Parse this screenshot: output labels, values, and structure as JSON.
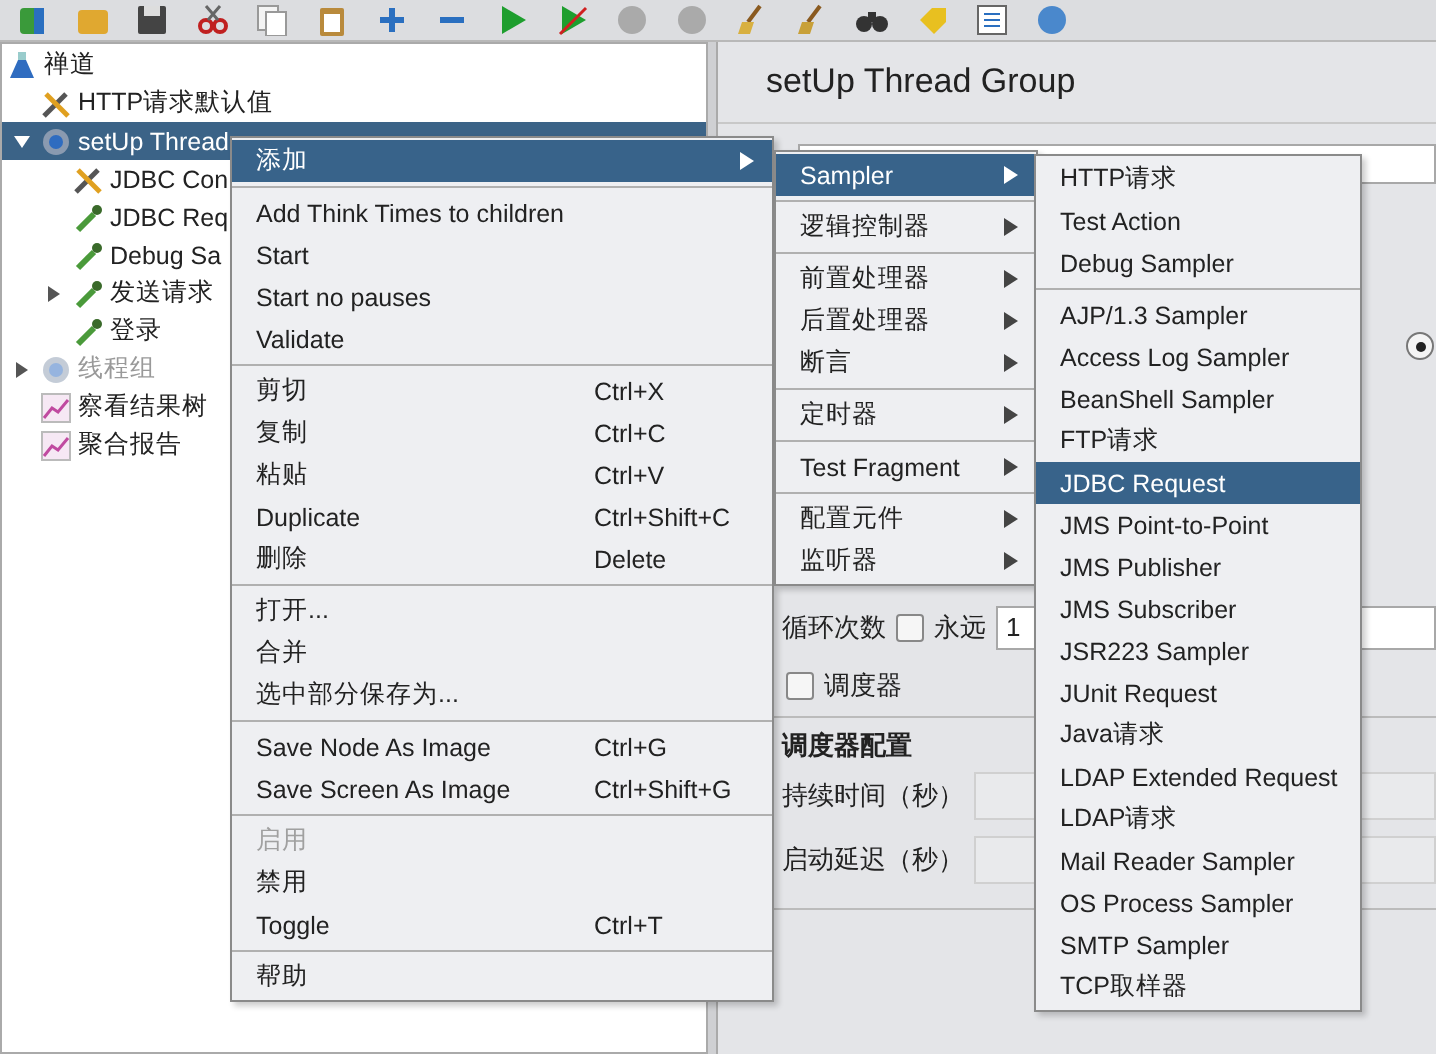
{
  "tree": [
    {
      "label": "禅道",
      "kind": "plan",
      "selected": false,
      "disabled": false,
      "children": [
        {
          "label": "HTTP请求默认值",
          "kind": "config",
          "selected": false,
          "disabled": false
        },
        {
          "label": "setUp Thread",
          "kind": "threads",
          "selected": true,
          "disabled": false,
          "expanded": true,
          "children": [
            {
              "label": "JDBC Con",
              "kind": "config",
              "selected": false,
              "disabled": false
            },
            {
              "label": "JDBC Req",
              "kind": "sampler",
              "selected": false,
              "disabled": false
            },
            {
              "label": "Debug Sa",
              "kind": "sampler",
              "selected": false,
              "disabled": false
            },
            {
              "label": "发送请求",
              "kind": "sampler",
              "selected": false,
              "disabled": false,
              "expanded": false
            },
            {
              "label": "登录",
              "kind": "sampler",
              "selected": false,
              "disabled": false
            }
          ]
        },
        {
          "label": "线程组",
          "kind": "threads",
          "selected": false,
          "disabled": true,
          "expanded": false
        },
        {
          "label": "察看结果树",
          "kind": "listener",
          "selected": false,
          "disabled": false
        },
        {
          "label": "聚合报告",
          "kind": "listener",
          "selected": false,
          "disabled": false
        }
      ]
    }
  ],
  "panel": {
    "title": "setUp Thread Group",
    "radio": {
      "selected": true
    },
    "loop": {
      "label": "循环次数",
      "forever": {
        "label": "永远",
        "checked": false
      },
      "value": "1"
    },
    "scheduler": {
      "label": "调度器",
      "checked": false
    },
    "scheduler_config": {
      "title": "调度器配置",
      "fields": [
        {
          "label": "持续时间（秒）"
        },
        {
          "label": "启动延迟（秒）"
        }
      ]
    }
  },
  "context_menu": {
    "sections": [
      [
        {
          "label": "添加",
          "selected": true,
          "disabled": false,
          "submenu": true
        }
      ],
      [
        {
          "label": "Add Think Times to children",
          "selected": false,
          "disabled": false
        },
        {
          "label": "Start",
          "selected": false,
          "disabled": false
        },
        {
          "label": "Start no pauses",
          "selected": false,
          "disabled": false
        },
        {
          "label": "Validate",
          "selected": false,
          "disabled": false
        }
      ],
      [
        {
          "label": "剪切",
          "shortcut": "Ctrl+X",
          "selected": false,
          "disabled": false
        },
        {
          "label": "复制",
          "shortcut": "Ctrl+C",
          "selected": false,
          "disabled": false
        },
        {
          "label": "粘贴",
          "shortcut": "Ctrl+V",
          "selected": false,
          "disabled": false
        },
        {
          "label": "Duplicate",
          "shortcut": "Ctrl+Shift+C",
          "selected": false,
          "disabled": false
        },
        {
          "label": "删除",
          "shortcut": "Delete",
          "selected": false,
          "disabled": false
        }
      ],
      [
        {
          "label": "打开...",
          "selected": false,
          "disabled": false
        },
        {
          "label": "合并",
          "selected": false,
          "disabled": false
        },
        {
          "label": "选中部分保存为...",
          "selected": false,
          "disabled": false
        }
      ],
      [
        {
          "label": "Save Node As Image",
          "shortcut": "Ctrl+G",
          "selected": false,
          "disabled": false
        },
        {
          "label": "Save Screen As Image",
          "shortcut": "Ctrl+Shift+G",
          "selected": false,
          "disabled": false
        }
      ],
      [
        {
          "label": "启用",
          "selected": false,
          "disabled": true
        },
        {
          "label": "禁用",
          "selected": false,
          "disabled": false
        },
        {
          "label": "Toggle",
          "shortcut": "Ctrl+T",
          "selected": false,
          "disabled": false
        }
      ],
      [
        {
          "label": "帮助",
          "selected": false,
          "disabled": false
        }
      ]
    ]
  },
  "add_menu": {
    "sections": [
      [
        {
          "label": "Sampler",
          "selected": true,
          "disabled": false,
          "submenu": true
        }
      ],
      [
        {
          "label": "逻辑控制器",
          "selected": false,
          "disabled": false,
          "submenu": true
        }
      ],
      [
        {
          "label": "前置处理器",
          "selected": false,
          "disabled": false,
          "submenu": true
        },
        {
          "label": "后置处理器",
          "selected": false,
          "disabled": false,
          "submenu": true
        },
        {
          "label": "断言",
          "selected": false,
          "disabled": false,
          "submenu": true
        }
      ],
      [
        {
          "label": "定时器",
          "selected": false,
          "disabled": false,
          "submenu": true
        }
      ],
      [
        {
          "label": "Test Fragment",
          "selected": false,
          "disabled": false,
          "submenu": true
        }
      ],
      [
        {
          "label": "配置元件",
          "selected": false,
          "disabled": false,
          "submenu": true
        },
        {
          "label": "监听器",
          "selected": false,
          "disabled": false,
          "submenu": true
        }
      ]
    ]
  },
  "sampler_menu": {
    "sections": [
      [
        {
          "label": "HTTP请求",
          "selected": false,
          "disabled": false
        },
        {
          "label": "Test Action",
          "selected": false,
          "disabled": false
        },
        {
          "label": "Debug Sampler",
          "selected": false,
          "disabled": false
        }
      ],
      [
        {
          "label": "AJP/1.3 Sampler",
          "selected": false,
          "disabled": false
        },
        {
          "label": "Access Log Sampler",
          "selected": false,
          "disabled": false
        },
        {
          "label": "BeanShell Sampler",
          "selected": false,
          "disabled": false
        },
        {
          "label": "FTP请求",
          "selected": false,
          "disabled": false
        },
        {
          "label": "JDBC Request",
          "selected": true,
          "disabled": false
        },
        {
          "label": "JMS Point-to-Point",
          "selected": false,
          "disabled": false
        },
        {
          "label": "JMS Publisher",
          "selected": false,
          "disabled": false
        },
        {
          "label": "JMS Subscriber",
          "selected": false,
          "disabled": false
        },
        {
          "label": "JSR223 Sampler",
          "selected": false,
          "disabled": false
        },
        {
          "label": "JUnit Request",
          "selected": false,
          "disabled": false
        },
        {
          "label": "Java请求",
          "selected": false,
          "disabled": false
        },
        {
          "label": "LDAP Extended Request",
          "selected": false,
          "disabled": false
        },
        {
          "label": "LDAP请求",
          "selected": false,
          "disabled": false
        },
        {
          "label": "Mail Reader Sampler",
          "selected": false,
          "disabled": false
        },
        {
          "label": "OS Process Sampler",
          "selected": false,
          "disabled": false
        },
        {
          "label": "SMTP Sampler",
          "selected": false,
          "disabled": false
        },
        {
          "label": "TCP取样器",
          "selected": false,
          "disabled": false
        }
      ]
    ]
  }
}
